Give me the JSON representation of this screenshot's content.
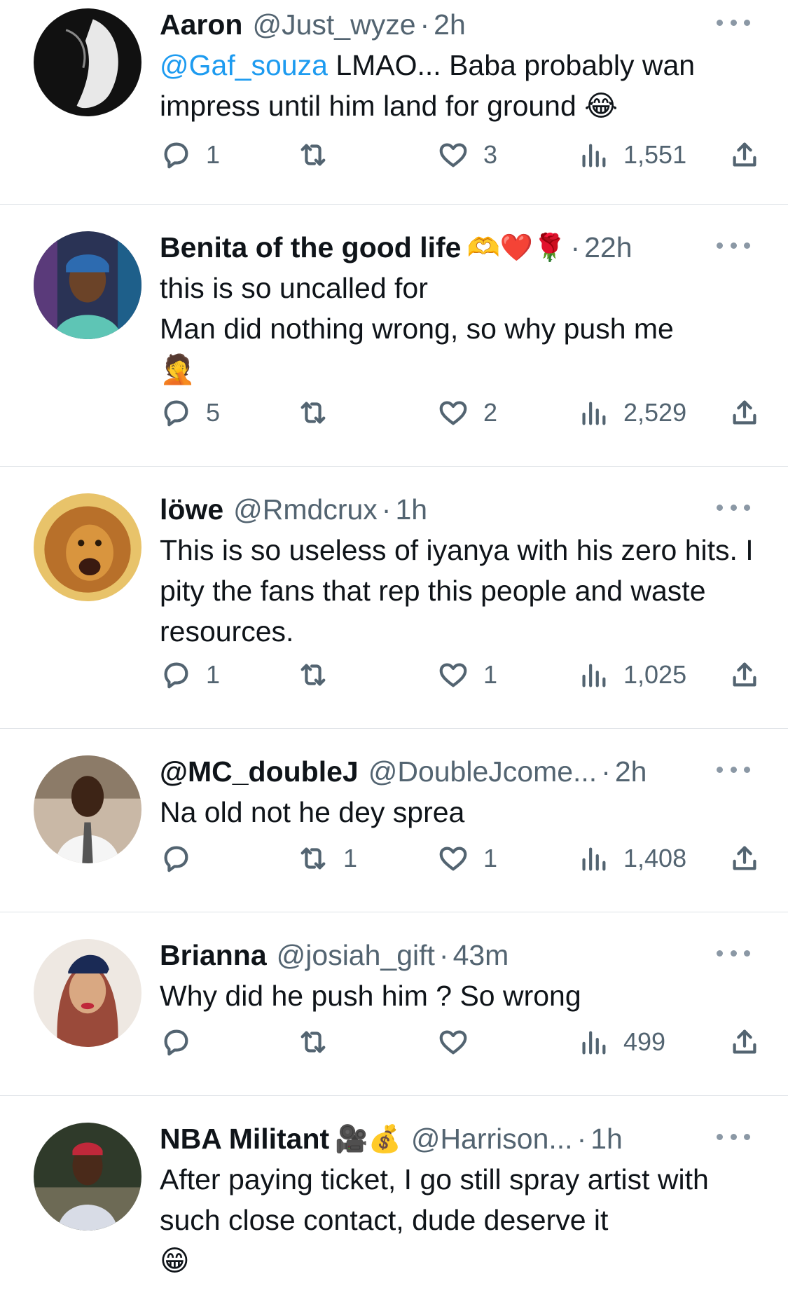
{
  "tweets": [
    {
      "name": "Aaron",
      "name_emoji": "",
      "handle": "@Just_wyze",
      "time": "2h",
      "mention": "@Gaf_souza",
      "text": " LMAO... Baba probably wan impress until him land for ground 😂",
      "replies": "1",
      "retweets": "",
      "likes": "3",
      "views": "1,551"
    },
    {
      "name": "Benita of the good life",
      "name_emoji": "🫶❤️🌹",
      "handle": "",
      "time": "22h",
      "mention": "",
      "text": "this is so uncalled for\nMan did nothing wrong, so why push me\n🤦",
      "replies": "5",
      "retweets": "",
      "likes": "2",
      "views": "2,529"
    },
    {
      "name": "löwe",
      "name_emoji": "",
      "handle": "@Rmdcrux",
      "time": "1h",
      "mention": "",
      "text": "This is so useless of iyanya with his zero hits. I pity the fans that rep this people and waste resources.",
      "replies": "1",
      "retweets": "",
      "likes": "1",
      "views": "1,025"
    },
    {
      "name": "@MC_doubleJ",
      "name_emoji": "",
      "handle": "@DoubleJcome...",
      "time": "2h",
      "mention": "",
      "text": "Na old not he dey sprea",
      "replies": "",
      "retweets": "1",
      "likes": "1",
      "views": "1,408"
    },
    {
      "name": "Brianna",
      "name_emoji": "",
      "handle": "@josiah_gift",
      "time": "43m",
      "mention": "",
      "text": "Why did he push him ? So wrong",
      "replies": "",
      "retweets": "",
      "likes": "",
      "views": "499"
    },
    {
      "name": "NBA Militant",
      "name_emoji": "🎥💰",
      "handle": "@Harrison...",
      "time": "1h",
      "mention": "",
      "text": "After paying ticket, I go still spray artist with such close contact, dude deserve it\n😁",
      "replies": "",
      "retweets": "",
      "likes": "",
      "views": ""
    }
  ],
  "colors": {
    "text": "#0f1419",
    "secondary": "#536471",
    "link": "#1d9bf0",
    "divider": "#dfe3e7"
  },
  "icons": [
    "reply-icon",
    "retweet-icon",
    "like-icon",
    "views-icon",
    "share-icon",
    "more-icon"
  ]
}
